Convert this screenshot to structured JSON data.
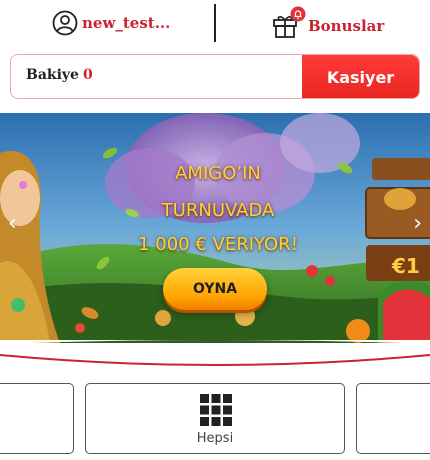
{
  "header": {
    "username": "new_test...",
    "bonus_label": "Bonuslar"
  },
  "balance": {
    "label": "Bakiye",
    "value": "0",
    "cashier_label": "Kasiyer"
  },
  "banner": {
    "line1": "AMIGO’IN",
    "line2": "TURNUVADA",
    "line3": "1 000 € VERIYOR!",
    "play_label": "OYNA",
    "prev_arrow": "‹",
    "next_arrow": "›"
  },
  "categories": {
    "main_label": "Hepsi"
  },
  "colors": {
    "accent": "#c8232f",
    "cashier": "#f0302a",
    "play_button": "#ffb300"
  }
}
